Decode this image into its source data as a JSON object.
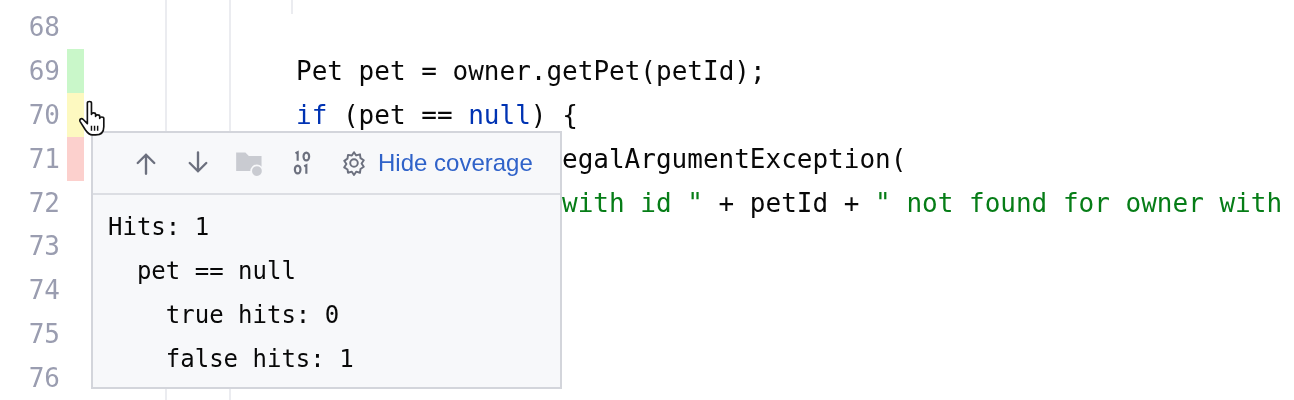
{
  "editor": {
    "lines": [
      {
        "number": "68"
      },
      {
        "number": "69",
        "color": "#c9f7c9",
        "tokens": [
          {
            "kind": "plain",
            "text": "Pet pet = owner.getPet(petId);"
          }
        ]
      },
      {
        "number": "70",
        "color": "#fdf9c0",
        "tokens": [
          {
            "kind": "keyword",
            "text": "if"
          },
          {
            "kind": "plain",
            "text": " (pet == "
          },
          {
            "kind": "keyword",
            "text": "null"
          },
          {
            "kind": "plain",
            "text": ") {"
          }
        ]
      },
      {
        "number": "71",
        "color": "#fcd0cd",
        "behind_popup": true,
        "tokens": [
          {
            "kind": "plain",
            "text": "egalArgumentException("
          }
        ]
      },
      {
        "number": "72",
        "behind_popup": true,
        "tokens": [
          {
            "kind": "string",
            "text": "with id \""
          },
          {
            "kind": "plain",
            "text": " + petId + "
          },
          {
            "kind": "string",
            "text": "\" not found for owner with"
          }
        ]
      },
      {
        "number": "73"
      },
      {
        "number": "74"
      },
      {
        "number": "75"
      },
      {
        "number": "76"
      }
    ]
  },
  "coverage_popup": {
    "toolbar": [
      {
        "kind": "up",
        "disabled": false
      },
      {
        "kind": "down",
        "disabled": false
      },
      {
        "kind": "folder",
        "disabled": true
      },
      {
        "kind": "binary",
        "disabled": false
      },
      {
        "kind": "settings",
        "disabled": false
      }
    ],
    "link": "Hide coverage",
    "details": [
      {
        "text": "Hits: 1",
        "children": [
          {
            "text": "pet == null",
            "children": [
              {
                "text": "true hits: 0"
              },
              {
                "text": "false hits: 1"
              }
            ]
          }
        ]
      }
    ]
  }
}
